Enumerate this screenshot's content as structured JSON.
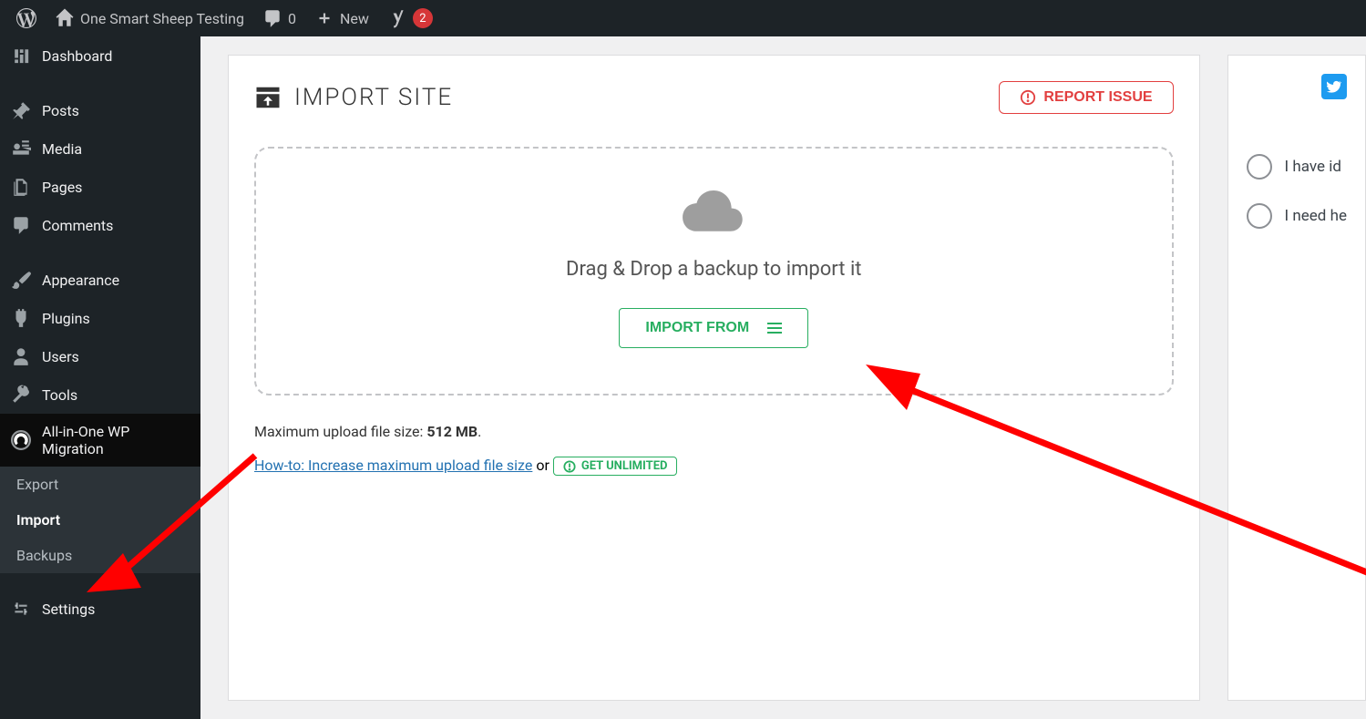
{
  "adminbar": {
    "site_name": "One Smart Sheep Testing",
    "comments": "0",
    "new_label": "New",
    "notif_count": "2"
  },
  "sidebar": {
    "dashboard": "Dashboard",
    "posts": "Posts",
    "media": "Media",
    "pages": "Pages",
    "comments": "Comments",
    "appearance": "Appearance",
    "plugins": "Plugins",
    "users": "Users",
    "tools": "Tools",
    "ai1wm": "All-in-One WP Migration",
    "export": "Export",
    "import": "Import",
    "backups": "Backups",
    "settings": "Settings"
  },
  "page": {
    "title": "IMPORT SITE",
    "report_issue": "REPORT ISSUE",
    "drop_text": "Drag & Drop a backup to import it",
    "import_from": "IMPORT FROM",
    "max_label": "Maximum upload file size: ",
    "max_value": "512 MB",
    "howto": "How-to: Increase maximum upload file size",
    "or": " or ",
    "get_unlimited": "GET UNLIMITED"
  },
  "side": {
    "opt1": "I have id",
    "opt2": "I need he"
  }
}
